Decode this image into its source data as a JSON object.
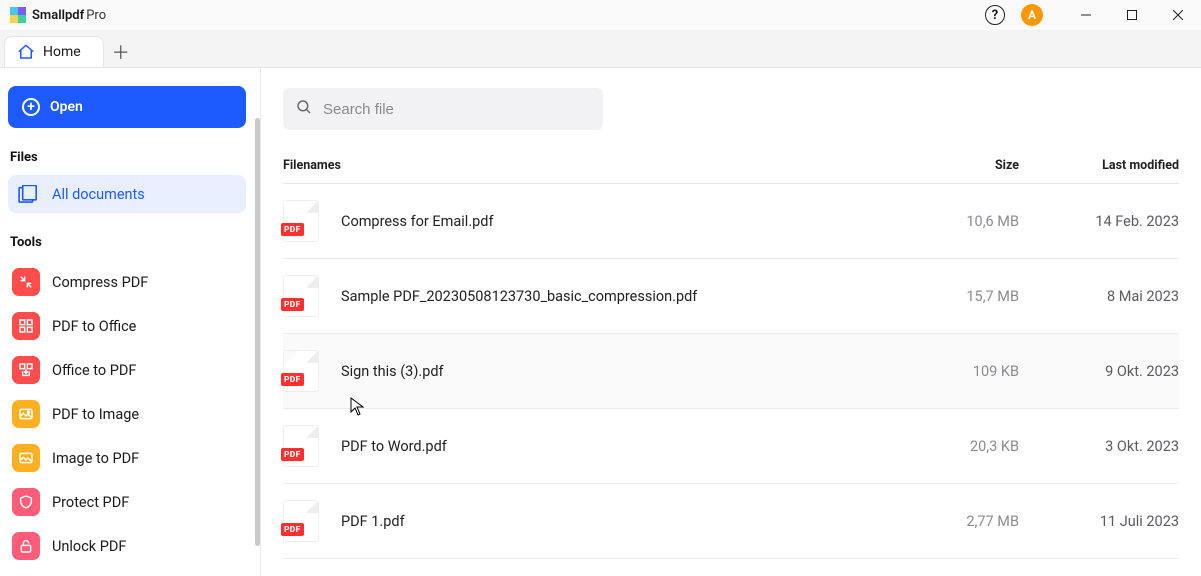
{
  "app": {
    "name": "Smallpdf",
    "suffix": "Pro",
    "avatar_letter": "A"
  },
  "tabs": {
    "home_label": "Home"
  },
  "sidebar": {
    "open_label": "Open",
    "files_label": "Files",
    "all_documents_label": "All documents",
    "tools_label": "Tools",
    "items": [
      {
        "label": "Compress PDF"
      },
      {
        "label": "PDF to Office"
      },
      {
        "label": "Office to PDF"
      },
      {
        "label": "PDF to Image"
      },
      {
        "label": "Image to PDF"
      },
      {
        "label": "Protect PDF"
      },
      {
        "label": "Unlock PDF"
      }
    ]
  },
  "search": {
    "placeholder": "Search file"
  },
  "table": {
    "headers": {
      "name": "Filenames",
      "size": "Size",
      "date": "Last modified"
    },
    "rows": [
      {
        "name": "Compress for Email.pdf",
        "size": "10,6 MB",
        "date": "14 Feb. 2023"
      },
      {
        "name": "Sample PDF_20230508123730_basic_compression.pdf",
        "size": "15,7 MB",
        "date": "8 Mai 2023"
      },
      {
        "name": "Sign this (3).pdf",
        "size": "109 KB",
        "date": "9 Okt. 2023"
      },
      {
        "name": "PDF to Word.pdf",
        "size": "20,3 KB",
        "date": "3 Okt. 2023"
      },
      {
        "name": "PDF 1.pdf",
        "size": "2,77 MB",
        "date": "11 Juli 2023"
      }
    ]
  },
  "icons": {
    "pdf_badge": "PDF"
  }
}
